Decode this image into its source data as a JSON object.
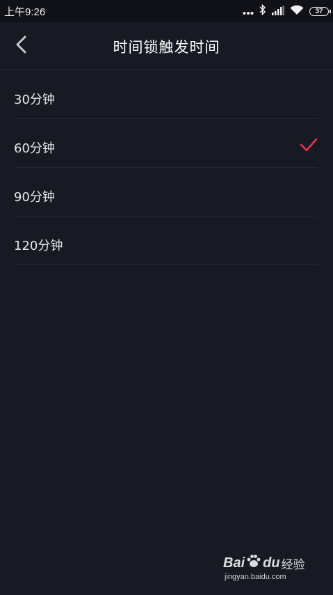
{
  "status_bar": {
    "time": "上午9:26",
    "battery": "37",
    "icons": [
      "dots-icon",
      "bluetooth-icon",
      "signal-icon",
      "wifi-icon",
      "battery-icon"
    ]
  },
  "nav": {
    "back_icon": "chevron-left-icon",
    "title": "时间锁触发时间"
  },
  "options": [
    {
      "label": "30分钟",
      "selected": false
    },
    {
      "label": "60分钟",
      "selected": true
    },
    {
      "label": "90分钟",
      "selected": false
    },
    {
      "label": "120分钟",
      "selected": false
    }
  ],
  "colors": {
    "background": "#171923",
    "status_bar": "#101218",
    "accent_check": "#e8344e",
    "divider": "#262935"
  },
  "watermark": {
    "logo_left": "Bai",
    "logo_right": "du",
    "suffix": "经验",
    "url": "jingyan.baidu.com"
  }
}
